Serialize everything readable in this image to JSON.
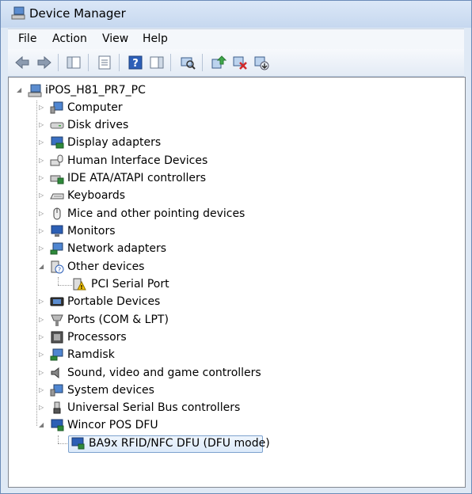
{
  "window": {
    "title": "Device Manager"
  },
  "menu": {
    "file": "File",
    "action": "Action",
    "view": "View",
    "help": "Help"
  },
  "toolbar": {
    "icons": [
      "back-arrow-icon",
      "forward-arrow-icon",
      "show-hide-console-tree-icon",
      "properties-icon",
      "help-icon",
      "action-pane-icon",
      "scan-hardware-icon",
      "update-driver-icon",
      "disable-device-icon",
      "uninstall-device-icon"
    ]
  },
  "tree": {
    "root": "iPOS_H81_PR7_PC",
    "categories": [
      "Computer",
      "Disk drives",
      "Display adapters",
      "Human Interface Devices",
      "IDE ATA/ATAPI controllers",
      "Keyboards",
      "Mice and other pointing devices",
      "Monitors",
      "Network adapters",
      "Other devices",
      "PCI Serial Port",
      "Portable Devices",
      "Ports (COM & LPT)",
      "Processors",
      "Ramdisk",
      "Sound, video and game controllers",
      "System devices",
      "Universal Serial Bus controllers",
      "Wincor POS DFU",
      "BA9x RFID/NFC DFU (DFU mode)"
    ]
  },
  "colors": {
    "selection_border": "#7da2ce",
    "warning": "#f2c200"
  }
}
